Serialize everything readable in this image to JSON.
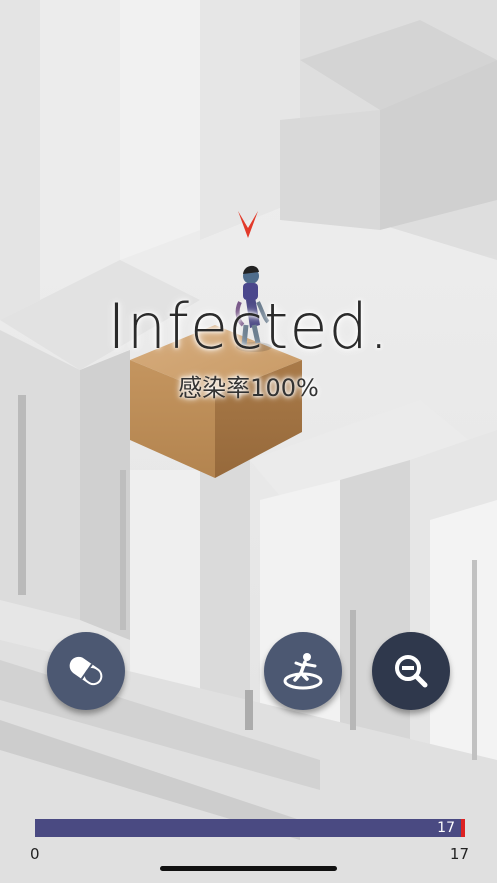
{
  "overlay": {
    "title": "Infected.",
    "subtitle": "感染率100%"
  },
  "buttons": {
    "pill": {
      "icon": "pill-icon"
    },
    "stance": {
      "icon": "character-stance-icon"
    },
    "zoom_out": {
      "icon": "zoom-out-icon"
    }
  },
  "progress": {
    "value": 17,
    "value_label": "17",
    "min_label": "0",
    "max_label": "17",
    "fraction": 1.0,
    "fill_color": "#4a4a82",
    "marker_color": "#dd2222"
  },
  "colors": {
    "button": "#4c5872",
    "button_dark": "#2f384c",
    "marker": "#e23a2a"
  }
}
